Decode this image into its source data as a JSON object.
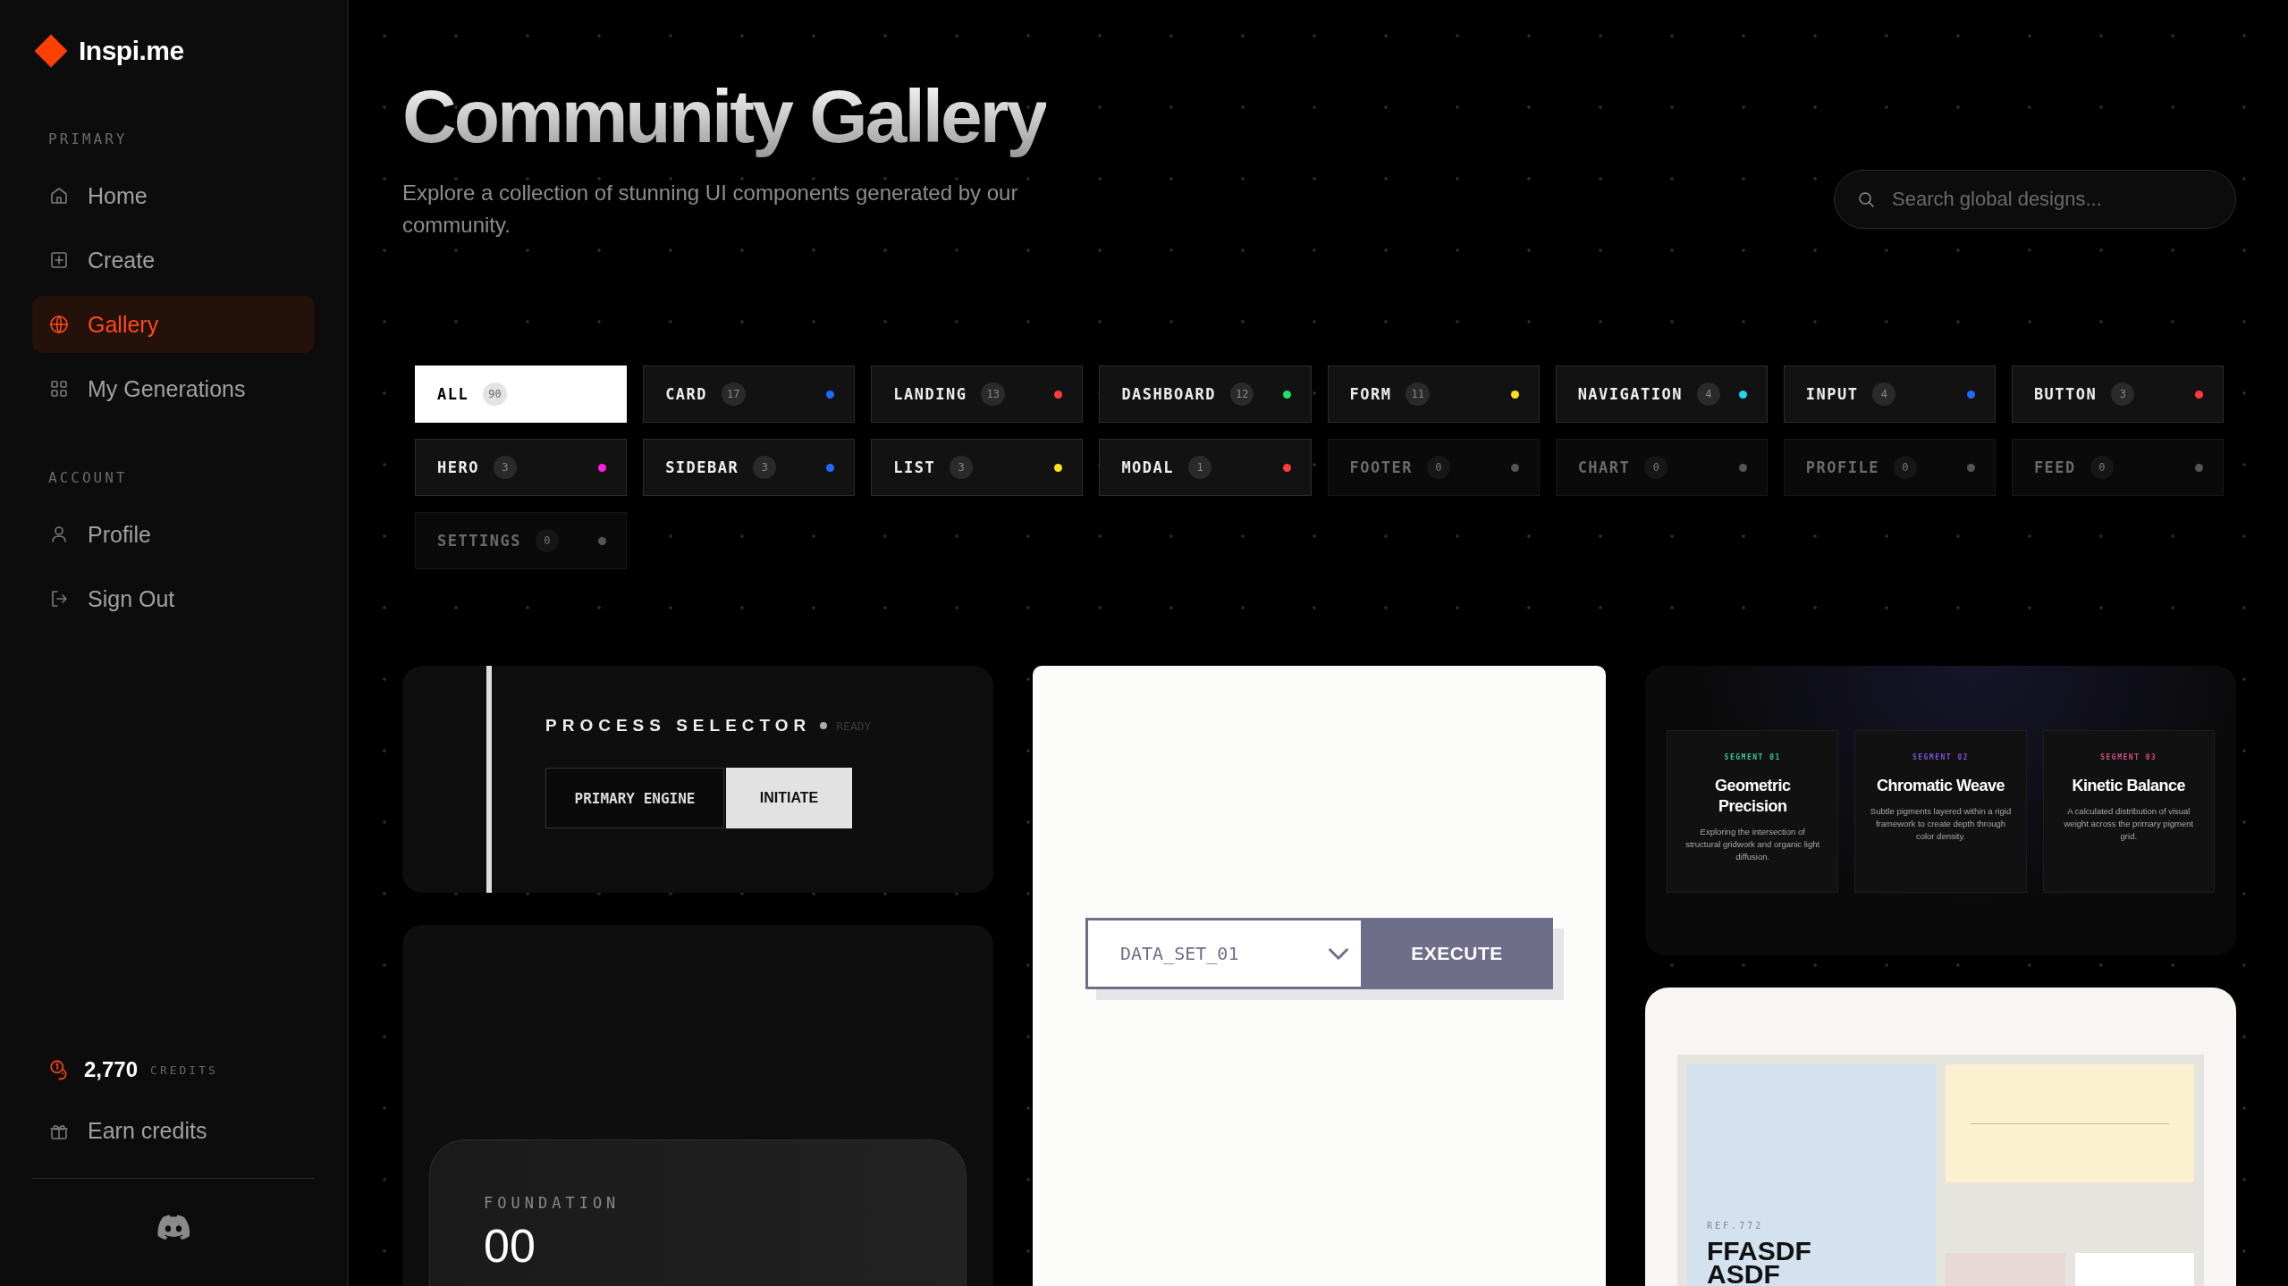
{
  "brand": {
    "name": "Inspi.me"
  },
  "sidebar": {
    "sections": [
      {
        "title": "PRIMARY",
        "items": [
          {
            "label": "Home",
            "selected": false
          },
          {
            "label": "Create",
            "selected": false
          },
          {
            "label": "Gallery",
            "selected": true
          },
          {
            "label": "My Generations",
            "selected": false
          }
        ]
      },
      {
        "title": "ACCOUNT",
        "items": [
          {
            "label": "Profile",
            "selected": false
          },
          {
            "label": "Sign Out",
            "selected": false
          }
        ]
      }
    ],
    "credits": {
      "amount": "2,770",
      "unit": "CREDITS"
    },
    "earn": {
      "label": "Earn credits"
    }
  },
  "header": {
    "title": "Community Gallery",
    "subtitle": "Explore a collection of stunning UI components generated by our community.",
    "search": {
      "placeholder": "Search global designs..."
    }
  },
  "filters": [
    {
      "label": "ALL",
      "count": "90",
      "selected": true,
      "disabled": false
    },
    {
      "label": "CARD",
      "count": "17",
      "color": "#1e6bff",
      "selected": false,
      "disabled": false
    },
    {
      "label": "LANDING",
      "count": "13",
      "color": "#ff3b3b",
      "selected": false,
      "disabled": false
    },
    {
      "label": "DASHBOARD",
      "count": "12",
      "color": "#22e06b",
      "selected": false,
      "disabled": false
    },
    {
      "label": "FORM",
      "count": "11",
      "color": "#ffe01a",
      "selected": false,
      "disabled": false
    },
    {
      "label": "NAVIGATION",
      "count": "4",
      "color": "#1ad8f0",
      "selected": false,
      "disabled": false
    },
    {
      "label": "INPUT",
      "count": "4",
      "color": "#1e6bff",
      "selected": false,
      "disabled": false
    },
    {
      "label": "BUTTON",
      "count": "3",
      "color": "#ff3b3b",
      "selected": false,
      "disabled": false
    },
    {
      "label": "HERO",
      "count": "3",
      "color": "#ff1ae0",
      "selected": false,
      "disabled": false
    },
    {
      "label": "SIDEBAR",
      "count": "3",
      "color": "#1e6bff",
      "selected": false,
      "disabled": false
    },
    {
      "label": "LIST",
      "count": "3",
      "color": "#ffe01a",
      "selected": false,
      "disabled": false
    },
    {
      "label": "MODAL",
      "count": "1",
      "color": "#ff3b3b",
      "selected": false,
      "disabled": false
    },
    {
      "label": "FOOTER",
      "count": "0",
      "color": "#555555",
      "selected": false,
      "disabled": true
    },
    {
      "label": "CHART",
      "count": "0",
      "color": "#555555",
      "selected": false,
      "disabled": true
    },
    {
      "label": "PROFILE",
      "count": "0",
      "color": "#555555",
      "selected": false,
      "disabled": true
    },
    {
      "label": "FEED",
      "count": "0",
      "color": "#555555",
      "selected": false,
      "disabled": true
    },
    {
      "label": "SETTINGS",
      "count": "0",
      "color": "#555555",
      "selected": false,
      "disabled": true
    }
  ],
  "gallery": {
    "process_card": {
      "title": "PROCESS SELECTOR",
      "status": "READY",
      "option": "PRIMARY ENGINE",
      "button": "INITIATE"
    },
    "foundation_card": {
      "label": "FOUNDATION",
      "number": "00"
    },
    "execute_card": {
      "select_value": "DATA_SET_01",
      "button": "EXECUTE"
    },
    "segments_card": {
      "segments": [
        {
          "label": "SEGMENT 01",
          "color": "#3fbf9a",
          "title": "Geometric Precision",
          "text": "Exploring the intersection of structural gridwork and organic light diffusion."
        },
        {
          "label": "SEGMENT 02",
          "color": "#7a52d6",
          "title": "Chromatic Weave",
          "text": "Subtle pigments layered within a rigid framework to create depth through color density."
        },
        {
          "label": "SEGMENT 03",
          "color": "#d04c86",
          "title": "Kinetic Balance",
          "text": "A calculated distribution of visual weight across the primary pigment grid."
        }
      ]
    },
    "poster_card": {
      "ref": "REF.772",
      "headline": "FFASDF ASDF"
    }
  }
}
